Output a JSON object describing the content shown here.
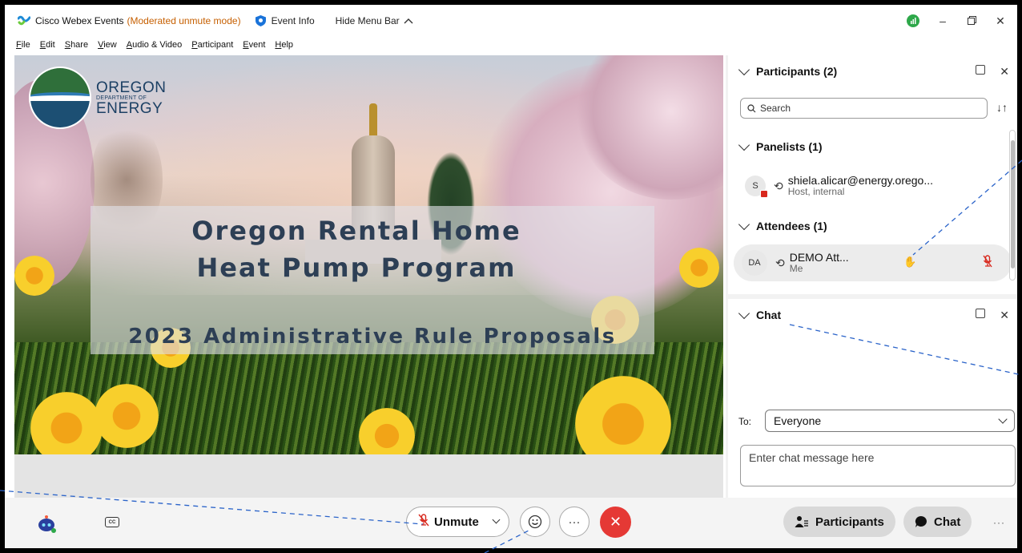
{
  "titlebar": {
    "app_name": "Cisco Webex Events",
    "mode": "(Moderated unmute mode)",
    "event_info": "Event Info",
    "hide_menu": "Hide Menu Bar"
  },
  "menu": [
    "File",
    "Edit",
    "Share",
    "View",
    "Audio & Video",
    "Participant",
    "Event",
    "Help"
  ],
  "slide": {
    "logo_line1": "OREGON",
    "logo_line2": "DEPARTMENT OF",
    "logo_line3": "ENERGY",
    "title_line1": "Oregon Rental Home",
    "title_line2": "Heat Pump Program",
    "title_line3": "2023 Administrative Rule Proposals"
  },
  "participants_panel": {
    "title": "Participants (2)",
    "search_placeholder": "Search",
    "panelists_header": "Panelists (1)",
    "attendees_header": "Attendees (1)",
    "panelists": [
      {
        "initial": "S",
        "name": "shiela.alicar@energy.orego...",
        "role": "Host, internal"
      }
    ],
    "attendees": [
      {
        "initials": "DA",
        "name": "DEMO Att...",
        "role": "Me"
      }
    ]
  },
  "chat_panel": {
    "title": "Chat",
    "to_label": "To:",
    "to_value": "Everyone",
    "input_placeholder": "Enter chat message here"
  },
  "toolbar": {
    "unmute_label": "Unmute",
    "participants_label": "Participants",
    "chat_label": "Chat",
    "cc_label": "CC",
    "more_label": "···"
  },
  "colors": {
    "accent_mode": "#c65f00",
    "end_call": "#e53935",
    "muted_red": "#d8281d",
    "annotation_line": "#2a63c9"
  }
}
